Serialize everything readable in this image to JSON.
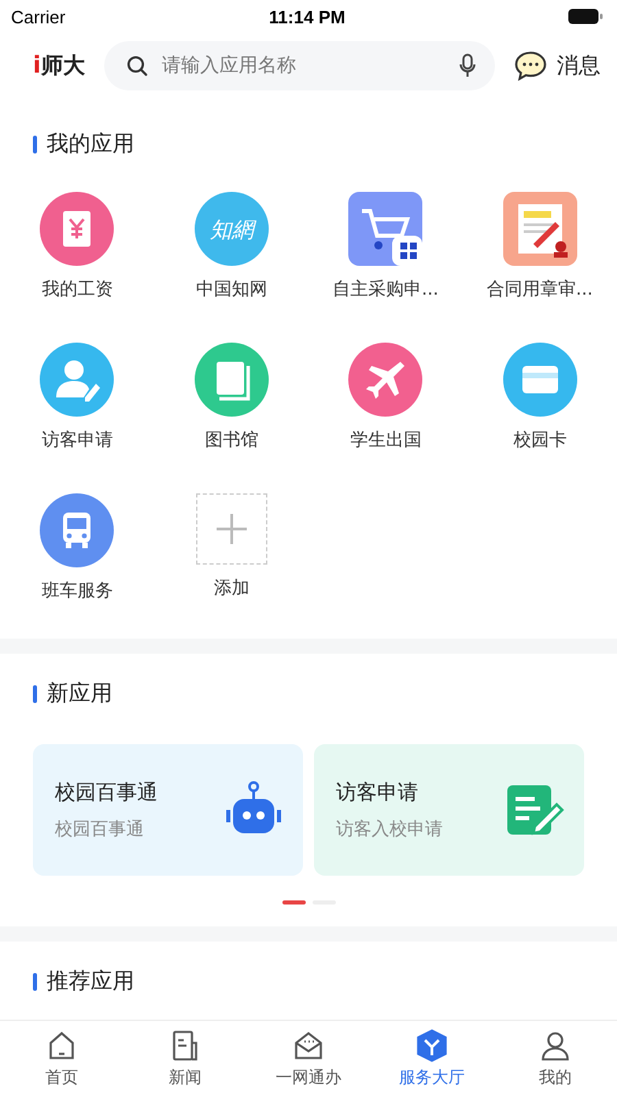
{
  "status_bar": {
    "carrier": "Carrier",
    "time": "11:14 PM"
  },
  "header": {
    "logo_mark": "i",
    "logo_text": "师大",
    "search": {
      "placeholder": "请输入应用名称"
    },
    "messages": "消息"
  },
  "my_apps": {
    "title": "我的应用",
    "items": [
      {
        "kind": "app",
        "label": "我的工资",
        "color": "#f0608f"
      },
      {
        "kind": "app",
        "label": "中国知网",
        "color": "#3fb9ec",
        "icon_text": "知網"
      },
      {
        "kind": "app",
        "label": "自主采购申...",
        "color": "#7e97f7"
      },
      {
        "kind": "app",
        "label": "合同用章审...",
        "color": "#f7a58c"
      },
      {
        "kind": "app",
        "label": "访客申请",
        "color": "#36b8ee"
      },
      {
        "kind": "app",
        "label": "图书馆",
        "color": "#2ec98e"
      },
      {
        "kind": "app",
        "label": "学生出国",
        "color": "#f2608f"
      },
      {
        "kind": "app",
        "label": "校园卡",
        "color": "#36b8ee"
      },
      {
        "kind": "app",
        "label": "班车服务",
        "color": "#5f8ff0"
      },
      {
        "kind": "add",
        "label": "添加"
      }
    ]
  },
  "new_apps": {
    "title": "新应用",
    "cards": [
      {
        "title": "校园百事通",
        "subtitle": "校园百事通",
        "color": "#eaf6fd"
      },
      {
        "title": "访客申请",
        "subtitle": "访客入校申请",
        "color": "#e6f8f2"
      }
    ],
    "pages": [
      {
        "selected": true
      },
      {
        "selected": false
      }
    ]
  },
  "recommended": {
    "title": "推荐应用"
  },
  "tab_bar": [
    {
      "label": "首页",
      "selected": false
    },
    {
      "label": "新闻",
      "selected": false
    },
    {
      "label": "一网通办",
      "selected": false
    },
    {
      "label": "服务大厅",
      "selected": true
    },
    {
      "label": "我的",
      "selected": false
    }
  ]
}
